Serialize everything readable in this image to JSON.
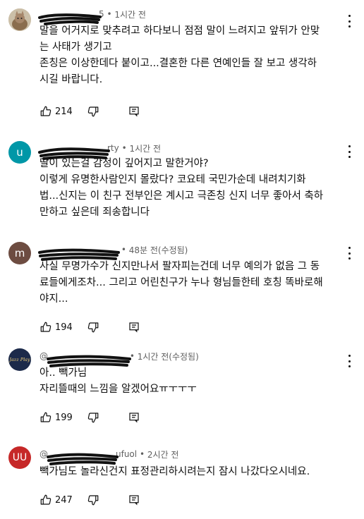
{
  "colors": {
    "meta_text": "#606060",
    "avatar_u": "#0097a7",
    "avatar_m": "#6d4c41",
    "avatar_uu": "#c62828",
    "scribble": "#111111"
  },
  "comments": [
    {
      "name_suffix": "5",
      "time": "1시간 전",
      "text": "말을 어거지로 맞추려고 하다보니 점점 말이 느려지고 앞뒤가 안맞\n는 사태가 생기고\n존칭은 이상한데다 붙이고...결혼한 다른 연예인들 잘 보고 생각하\n시길 바랍니다.",
      "likes": "214",
      "avatar_icon": "cat-photo-avatar"
    },
    {
      "avatar_letter": "u",
      "name_suffix": "rty",
      "time": "1시간 전",
      "text": "딸이 있는걸 감정이 깊어지고 말한거야?\n이렇게 유명한사람인지 몰랐다? 코요테 국민가순데 내려치기화\n법...신지는 이 친구 전부인은 계시고 극존칭 신지 너무 좋아서 축하\n만하고 싶은데 죄송합니다"
    },
    {
      "avatar_letter": "m",
      "name_suffix": "",
      "time": "48분 전(수정됨)",
      "text": "사실 무명가수가 신지만나서 팔자피는건데 너무 예의가 없음 그 동\n료들에게조차... 그리고 어린친구가 누나 형님들한테 호칭 똑바로해\n야지...",
      "likes": "194"
    },
    {
      "avatar_text": "Jazz Play",
      "name_prefix": "@",
      "time": "1시간 전(수정됨)",
      "text": "아.. 빽가님\n자리뜰때의 느낌을 알겠어요ㅠㅜㅜㅜ",
      "likes": "199"
    },
    {
      "avatar_letter": "UU",
      "name_prefix": "@",
      "name_suffix": "ufuol",
      "time": "2시간 전",
      "text": "빽가님도 놀라신건지 표정관리하시려는지 잠시 나갔다오시네요.",
      "likes": "247"
    }
  ]
}
